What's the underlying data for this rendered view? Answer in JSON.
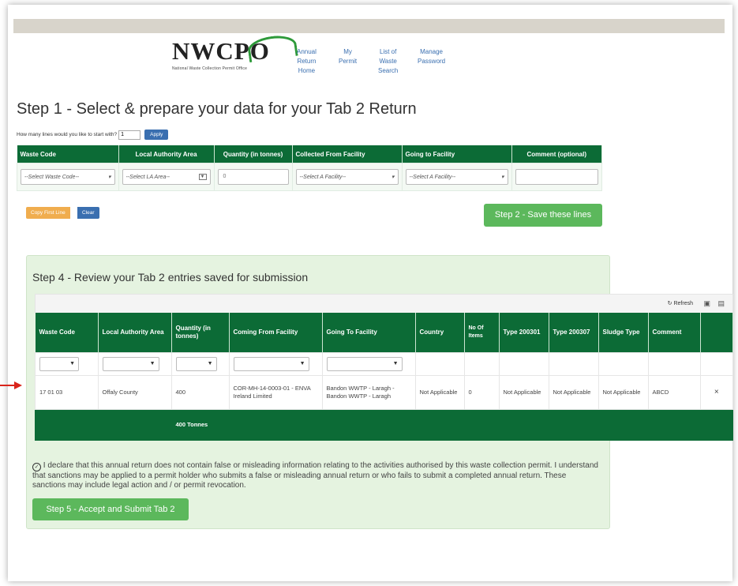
{
  "logo": {
    "name": "NWCPO",
    "subtitle": "National Waste Collection Permit Office"
  },
  "nav": [
    {
      "lines": [
        "Annual",
        "Return",
        "Home"
      ]
    },
    {
      "lines": [
        "My",
        "Permit"
      ]
    },
    {
      "lines": [
        "List of",
        "Waste",
        "Search"
      ]
    },
    {
      "lines": [
        "Manage",
        "Password"
      ]
    }
  ],
  "step1": {
    "title": "Step 1 -  Select & prepare your data for your Tab 2 Return",
    "lines_question": "How many lines would you like to start with?",
    "lines_value": "1",
    "apply_label": "Apply",
    "headers": [
      "Waste Code",
      "Local Authority Area",
      "Quantity (in tonnes)",
      "Collected From Facility",
      "Going to Facility",
      "Comment (optional)"
    ],
    "waste_code_placeholder": "--Select Waste Code--",
    "la_placeholder": "--Select LA Area--",
    "quantity_value": "0",
    "collected_placeholder": "--Select A Facility--",
    "going_placeholder": "--Select A Facility--",
    "comment_value": ""
  },
  "buttons": {
    "copy_first_line": "Copy First Line",
    "clear": "Clear",
    "step2": "Step 2 - Save these lines",
    "step5": "Step 5 - Accept and Submit Tab 2"
  },
  "step4": {
    "title": "Step 4 - Review your Tab 2 entries saved for submission",
    "refresh_label": "Refresh",
    "headers": [
      "Waste Code",
      "Local Authority Area",
      "Quantity (in tonnes)",
      "Coming From Facility",
      "Going To Facility",
      "Country",
      "No Of Items",
      "Type 200301",
      "Type 200307",
      "Sludge Type",
      "Comment",
      ""
    ],
    "rows": [
      [
        "17 01 03",
        "Offaly County",
        "400",
        "COR-MH-14-0003-01 - ENVA Ireland Limited",
        "Bandon WWTP - Laragh - Bandon WWTP - Laragh",
        "Not Applicable",
        "0",
        "Not Applicable",
        "Not Applicable",
        "Not Applicable",
        "ABCD",
        "×"
      ]
    ],
    "total_quantity": "400 Tonnes"
  },
  "declaration": "I declare that this annual return does not contain false or misleading information relating to the activities authorised by this waste collection permit. I understand that sanctions may be applied to a permit holder who submits a false or misleading annual return or who fails to submit a completed annual return. These sanctions may include legal action and / or permit revocation.",
  "colors": {
    "header_green": "#0c6b36",
    "button_green": "#5cb85c",
    "panel_green": "#e5f3e0",
    "link_blue": "#3a6fb0",
    "arrow_red": "#d9241b"
  }
}
